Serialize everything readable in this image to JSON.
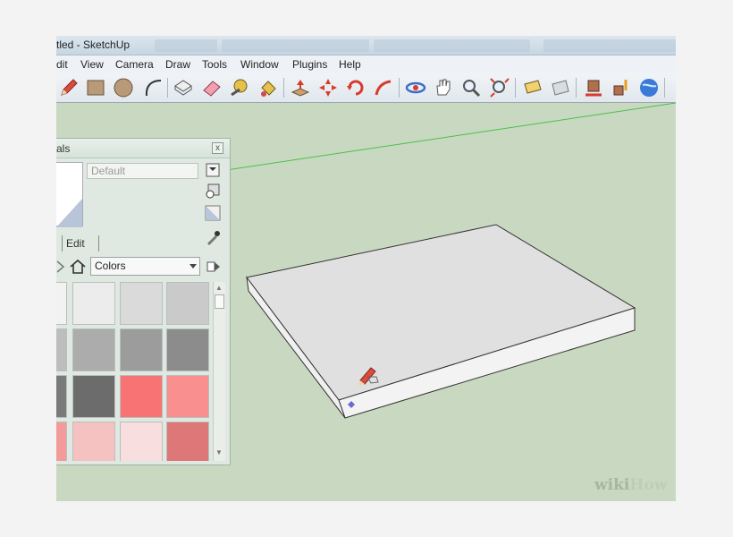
{
  "window": {
    "title": "tled - SketchUp"
  },
  "menu": [
    "dit",
    "View",
    "Camera",
    "Draw",
    "Tools",
    "Window",
    "Plugins",
    "Help"
  ],
  "toolbar": {
    "tools": [
      "pencil-icon",
      "rectangle-icon",
      "circle-icon",
      "arc-icon",
      "make-component-icon",
      "eraser-icon",
      "tape-measure-icon",
      "paint-bucket-icon",
      "push-pull-icon",
      "move-icon",
      "rotate-icon",
      "follow-me-icon",
      "orbit-icon",
      "pan-icon",
      "zoom-icon",
      "zoom-extents-icon",
      "add-location-icon",
      "toggle-terrain-icon",
      "get-models-icon",
      "share-model-icon",
      "share-component-icon",
      "google-earth-icon"
    ]
  },
  "materials": {
    "title": "als",
    "close_label": "x",
    "name_placeholder": "Default",
    "edit_tab": "Edit",
    "library": "Colors",
    "swatch_colors": [
      [
        "#f2f2f2",
        "#ececec",
        "#dadada",
        "#cacaca"
      ],
      [
        "#bdbdbd",
        "#acacac",
        "#9c9c9c",
        "#8c8c8c"
      ],
      [
        "#7a7a7a",
        "#6c6c6c",
        "#f87474",
        "#f98f8f"
      ],
      [
        "#f39b9b",
        "#f6c1c1",
        "#f8dede",
        "#de7777"
      ]
    ]
  },
  "watermark": {
    "prefix": "wiki",
    "suffix": "How"
  },
  "colors": {
    "viewport": "#c9d9c1",
    "box_top": "#e0e0e0",
    "box_side": "#f3f3f3",
    "axis_green": "#4bbf4b"
  }
}
